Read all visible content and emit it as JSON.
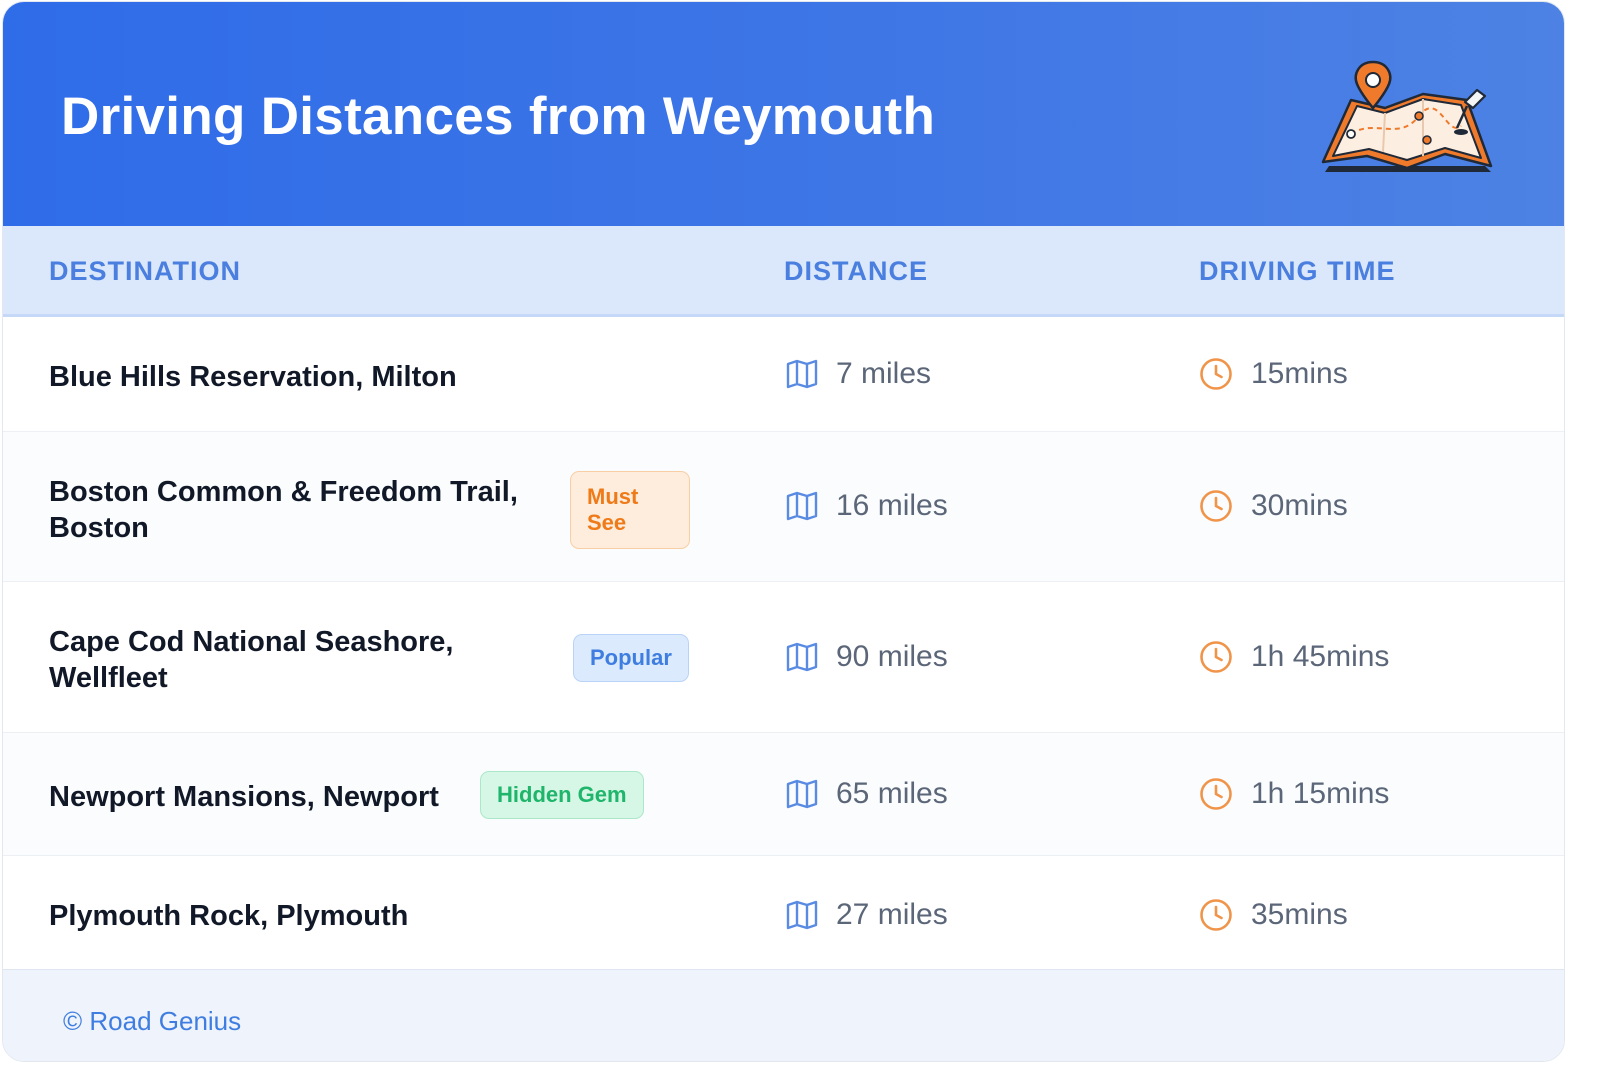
{
  "header": {
    "title": "Driving Distances from Weymouth",
    "illustration_icon": "map-with-pins-icon"
  },
  "table": {
    "columns": [
      "DESTINATION",
      "DISTANCE",
      "DRIVING TIME"
    ],
    "rows": [
      {
        "destination": "Blue Hills Reservation, Milton",
        "badge": "",
        "distance": "7 miles",
        "time": "15mins"
      },
      {
        "destination": "Boston Common & Freedom Trail, Boston",
        "badge": "Must See",
        "distance": "16 miles",
        "time": "30mins"
      },
      {
        "destination": "Cape Cod National Seashore, Wellfleet",
        "badge": "Popular",
        "distance": "90 miles",
        "time": "1h 45mins"
      },
      {
        "destination": "Newport Mansions, Newport",
        "badge": "Hidden Gem",
        "distance": "65 miles",
        "time": "1h 15mins"
      },
      {
        "destination": "Plymouth Rock, Plymouth",
        "badge": "",
        "distance": "27 miles",
        "time": "35mins"
      }
    ]
  },
  "icons": {
    "distance": "map-icon",
    "time": "clock-icon"
  },
  "footer": {
    "text": "© Road Genius"
  },
  "colors": {
    "header": "#3a72e6",
    "accent": "#4a7fe0",
    "must_see": "#ef7a18",
    "popular": "#3f7ee0",
    "hidden_gem": "#1fb56b",
    "clock": "#f0944a"
  }
}
